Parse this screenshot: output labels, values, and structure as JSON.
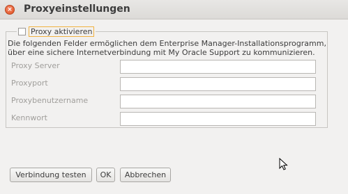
{
  "window": {
    "title": "Proxyeinstellungen",
    "close_glyph": "×"
  },
  "proxy": {
    "enable_label": "Proxy aktivieren",
    "enabled": false,
    "description_line1": "Die folgenden Felder ermöglichen dem Enterprise Manager-Installationsprogramm,",
    "description_line2": "über eine sichere Internetverbindung mit My Oracle Support zu kommunizieren."
  },
  "fields": {
    "server_label": "Proxy Server",
    "server_value": "",
    "port_label": "Proxyport",
    "port_value": "",
    "user_label": "Proxybenutzername",
    "user_value": "",
    "password_label": "Kennwort",
    "password_value": ""
  },
  "buttons": {
    "test_label": "Verbindung testen",
    "ok_label": "OK",
    "cancel_label": "Abbrechen"
  }
}
